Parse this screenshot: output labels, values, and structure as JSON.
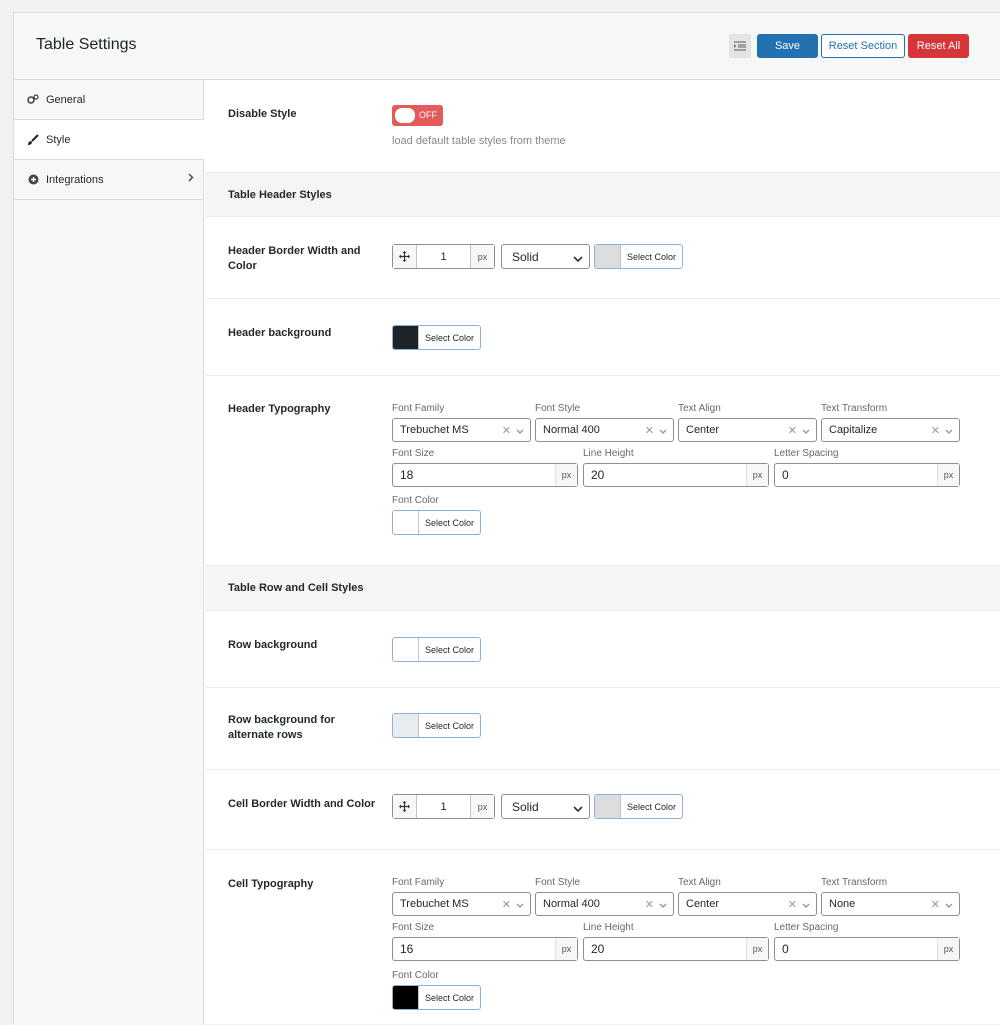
{
  "header": {
    "title": "Table Settings",
    "save": "Save",
    "reset_section": "Reset Section",
    "reset_all": "Reset All"
  },
  "sidebar": {
    "items": [
      {
        "label": "General",
        "icon": "gears-icon"
      },
      {
        "label": "Style",
        "icon": "brush-icon",
        "active": true
      },
      {
        "label": "Integrations",
        "icon": "plus-circle-icon"
      }
    ]
  },
  "disable_style": {
    "label": "Disable Style",
    "toggle": "OFF",
    "desc": "load default table styles from theme"
  },
  "header_section": {
    "title": "Table Header Styles",
    "border_label": "Header Border Width and Color",
    "border_width": "1",
    "border_unit": "px",
    "border_style": "Solid",
    "select_color": "Select Color",
    "background_label": "Header background",
    "typography_label": "Header Typography",
    "font_family_label": "Font Family",
    "font_family": "Trebuchet MS",
    "font_style_label": "Font Style",
    "font_style": "Normal 400",
    "text_align_label": "Text Align",
    "text_align": "Center",
    "text_transform_label": "Text Transform",
    "text_transform": "Capitalize",
    "font_size_label": "Font Size",
    "font_size": "18",
    "line_height_label": "Line Height",
    "line_height": "20",
    "letter_spacing_label": "Letter Spacing",
    "letter_spacing": "0",
    "unit": "px",
    "font_color_label": "Font Color"
  },
  "row_section": {
    "title": "Table Row and Cell Styles",
    "row_bg_label": "Row background",
    "alt_row_bg_label": "Row background for alternate rows",
    "cell_border_label": "Cell Border Width and Color",
    "border_width": "1",
    "border_unit": "px",
    "border_style": "Solid",
    "select_color": "Select Color",
    "typography_label": "Cell Typography",
    "font_family_label": "Font Family",
    "font_family": "Trebuchet MS",
    "font_style_label": "Font Style",
    "font_style": "Normal 400",
    "text_align_label": "Text Align",
    "text_align": "Center",
    "text_transform_label": "Text Transform",
    "text_transform": "None",
    "font_size_label": "Font Size",
    "font_size": "16",
    "line_height_label": "Line Height",
    "line_height": "20",
    "letter_spacing_label": "Letter Spacing",
    "letter_spacing": "0",
    "unit": "px",
    "font_color_label": "Font Color"
  },
  "colors": {
    "header_border": "#dddddd",
    "header_bg": "#1d2327",
    "header_font": "#ffffff",
    "row_bg": "#ffffff",
    "alt_row_bg": "#e8ecf0",
    "cell_border": "#dddddd",
    "cell_font": "#000000"
  }
}
